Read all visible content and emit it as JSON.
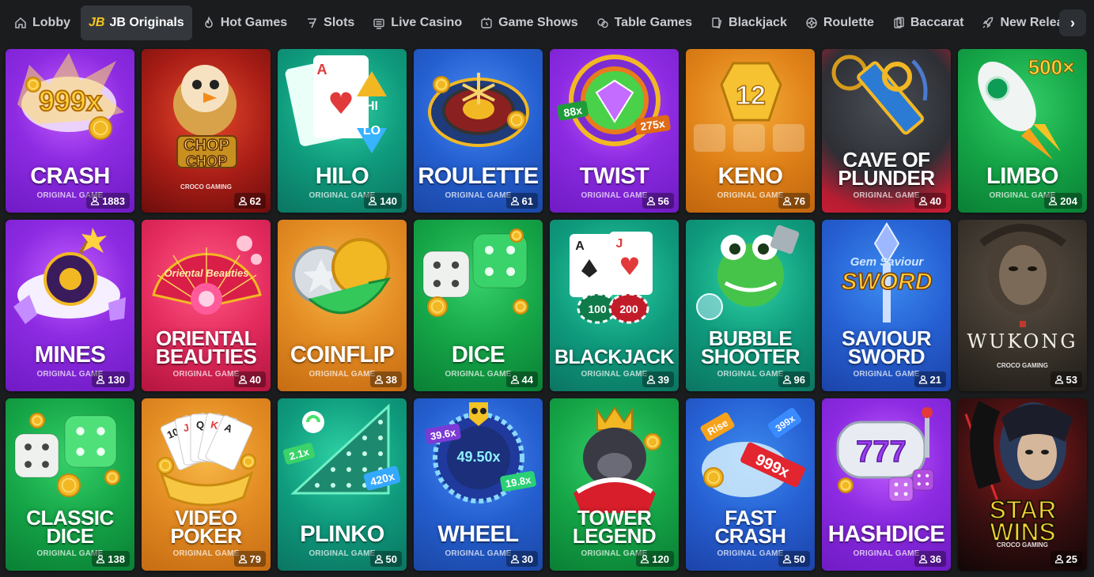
{
  "nav": {
    "items": [
      {
        "label": "Lobby",
        "icon": "home-icon",
        "active": false
      },
      {
        "label": "JB Originals",
        "logo": "JB",
        "icon": "jb-logo",
        "active": true
      },
      {
        "label": "Hot Games",
        "icon": "flame-icon",
        "active": false
      },
      {
        "label": "Slots",
        "icon": "slot-seven-icon",
        "active": false
      },
      {
        "label": "Live Casino",
        "icon": "tv-icon",
        "active": false
      },
      {
        "label": "Game Shows",
        "icon": "stopwatch-icon",
        "active": false
      },
      {
        "label": "Table Games",
        "icon": "chips-icon",
        "active": false
      },
      {
        "label": "Blackjack",
        "icon": "cards-icon",
        "active": false
      },
      {
        "label": "Roulette",
        "icon": "roulette-icon",
        "active": false
      },
      {
        "label": "Baccarat",
        "icon": "baccarat-icon",
        "active": false
      },
      {
        "label": "New Releases",
        "icon": "rocket-icon",
        "active": false
      }
    ],
    "next_icon": "chevron-right-icon",
    "next_glyph": "›"
  },
  "tiles": [
    {
      "title": "CRASH",
      "subtitle": "ORIGINAL GAME",
      "players": "1883",
      "theme": "purple"
    },
    {
      "title": "CHOP CHOP",
      "provider": "CROCO GAMING",
      "players": "62",
      "theme": "red"
    },
    {
      "title": "HILO",
      "subtitle": "ORIGINAL GAME",
      "players": "140",
      "theme": "teal"
    },
    {
      "title": "ROULETTE",
      "subtitle": "ORIGINAL GAME",
      "players": "61",
      "theme": "blue"
    },
    {
      "title": "TWIST",
      "subtitle": "ORIGINAL GAME",
      "players": "56",
      "theme": "purple"
    },
    {
      "title": "KENO",
      "subtitle": "ORIGINAL GAME",
      "players": "76",
      "theme": "orange"
    },
    {
      "title": "CAVE OF PLUNDER",
      "subtitle": "ORIGINAL GAME",
      "players": "40",
      "theme": "cave"
    },
    {
      "title": "LIMBO",
      "subtitle": "ORIGINAL GAME",
      "players": "204",
      "theme": "green"
    },
    {
      "title": "MINES",
      "subtitle": "ORIGINAL GAME",
      "players": "130",
      "theme": "purple"
    },
    {
      "title": "ORIENTAL BEAUTIES",
      "subtitle": "ORIGINAL GAME",
      "players": "40",
      "theme": "pink"
    },
    {
      "title": "COINFLIP",
      "subtitle": "ORIGINAL GAME",
      "players": "38",
      "theme": "gold"
    },
    {
      "title": "DICE",
      "subtitle": "ORIGINAL GAME",
      "players": "44",
      "theme": "green"
    },
    {
      "title": "BLACKJACK",
      "subtitle": "ORIGINAL GAME",
      "players": "39",
      "theme": "teal"
    },
    {
      "title": "BUBBLE SHOOTER",
      "subtitle": "ORIGINAL GAME",
      "players": "96",
      "theme": "teal"
    },
    {
      "title": "SAVIOUR SWORD",
      "subtitle": "ORIGINAL GAME",
      "players": "21",
      "theme": "navy"
    },
    {
      "title": "WUKONG",
      "provider": "CROCO GAMING",
      "players": "53",
      "theme": "wukong"
    },
    {
      "title": "CLASSIC DICE",
      "subtitle": "ORIGINAL GAME",
      "players": "138",
      "theme": "green"
    },
    {
      "title": "VIDEO POKER",
      "subtitle": "ORIGINAL GAME",
      "players": "79",
      "theme": "gold"
    },
    {
      "title": "PLINKO",
      "subtitle": "ORIGINAL GAME",
      "players": "50",
      "theme": "teal"
    },
    {
      "title": "WHEEL",
      "subtitle": "ORIGINAL GAME",
      "players": "30",
      "theme": "blue"
    },
    {
      "title": "TOWER LEGEND",
      "subtitle": "ORIGINAL GAME",
      "players": "120",
      "theme": "green"
    },
    {
      "title": "FAST CRASH",
      "subtitle": "ORIGINAL GAME",
      "players": "50",
      "theme": "navy"
    },
    {
      "title": "HASHDICE",
      "subtitle": "ORIGINAL GAME",
      "players": "36",
      "theme": "purple"
    },
    {
      "title": "STAR WINS",
      "provider": "CROCO GAMING",
      "players": "25",
      "theme": "star"
    }
  ],
  "art_text": {
    "crash": "999x",
    "hilo_hi": "HI",
    "hilo_lo": "LO",
    "hilo_card": "A",
    "twist_left": "88x",
    "twist_right": "275x",
    "keno": "12",
    "limbo": "500×",
    "savior_logo_top": "Gem Saviour",
    "savior_logo_bottom": "SWORD",
    "oriental_logo": "Oriental Beauties",
    "blackjack_chip1": "100",
    "blackjack_chip2": "200",
    "plinko_left": "2.1x",
    "plinko_right": "420x",
    "wheel_center": "49.50x",
    "wheel_left": "39.6x",
    "wheel_right": "19.8x",
    "fastcrash_rise": "Rise",
    "fastcrash_big": "999x",
    "fastcrash_small": "399x",
    "hashdice": "777",
    "videopoker_cards": [
      "10",
      "J",
      "Q",
      "K",
      "A"
    ]
  },
  "colors": {
    "background": "#1a1c1e",
    "nav_active": "#34383d",
    "jb_logo": "#f5c518"
  }
}
